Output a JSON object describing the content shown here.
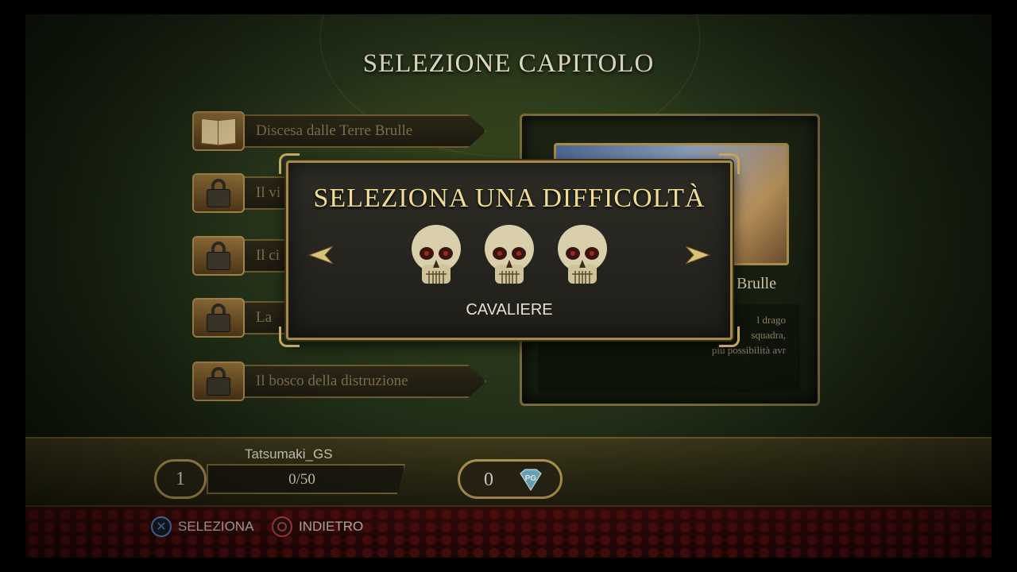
{
  "screen": {
    "title": "SELEZIONE CAPITOLO"
  },
  "chapters": [
    {
      "label": "Discesa dalle Terre Brulle",
      "icon": "book-icon",
      "locked": false
    },
    {
      "label": "Il vi",
      "icon": "lock-icon",
      "locked": true
    },
    {
      "label": "Il ci",
      "icon": "lock-icon",
      "locked": true
    },
    {
      "label": "La",
      "icon": "lock-icon",
      "locked": true
    },
    {
      "label": "Il bosco della distruzione",
      "icon": "lock-icon",
      "locked": true
    }
  ],
  "detail": {
    "title_fragment": "Brulle",
    "text_line1": "l drago",
    "text_line2": "squadra,",
    "text_line3": "più possibilità avr"
  },
  "difficulty_modal": {
    "title": "SELEZIONA UNA DIFFICOLTÀ",
    "selected_difficulty": "CAVALIERE",
    "skull_count": 3,
    "left_arrow": "arrow-left-icon",
    "right_arrow": "arrow-right-icon"
  },
  "player": {
    "name": "Tatsumaki_GS",
    "level": "1",
    "xp": "0/50",
    "xp_fraction": 0,
    "gems": "0",
    "gem_icon_text": "PG"
  },
  "controls": {
    "select_label": "SELEZIONA",
    "back_label": "INDIETRO"
  },
  "colors": {
    "title_gold": "#f0dd93",
    "frame_gold": "#a48a48",
    "background_green": "#26341a",
    "footer_red": "#3d0b0b"
  }
}
